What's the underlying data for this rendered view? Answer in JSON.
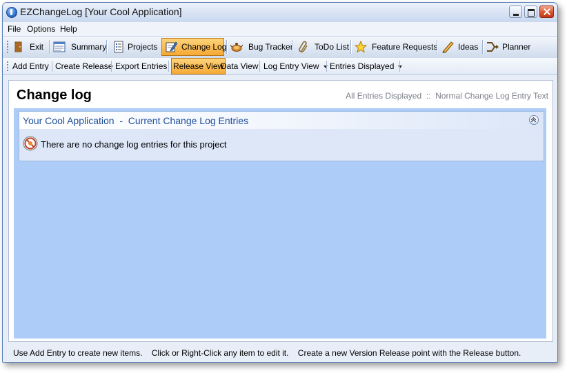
{
  "window": {
    "title": "EZChangeLog [Your Cool Application]"
  },
  "menu": [
    "File",
    "Options",
    "Help"
  ],
  "toolbar": {
    "buttons": [
      {
        "label": "Exit",
        "icon": "exit-icon"
      },
      {
        "label": "Summary",
        "icon": "summary-icon"
      },
      {
        "label": "Projects",
        "icon": "projects-icon"
      },
      {
        "label": "Change Log",
        "icon": "change-log-icon",
        "active": true
      },
      {
        "label": "Bug Tracker",
        "icon": "bug-tracker-icon"
      },
      {
        "label": "ToDo List",
        "icon": "paperclip-icon"
      },
      {
        "label": "Feature Requests",
        "icon": "star-icon"
      },
      {
        "label": "Ideas",
        "icon": "pencil-icon"
      },
      {
        "label": "Planner",
        "icon": "planner-icon"
      }
    ]
  },
  "subtoolbar": {
    "items": [
      "Add Entry",
      "Create Release",
      "Export Entries",
      "Release View",
      "Data View",
      "Log Entry View",
      "Entries Displayed"
    ],
    "active_item": "Release View"
  },
  "content": {
    "title": "Change log",
    "header_right": "All Entries Displayed  ::  Normal Change Log Entry Text",
    "panel": {
      "title": "Your Cool Application  -  Current Change Log Entries",
      "empty_message": "There are no change log entries for this project"
    }
  },
  "status": "Use Add Entry to create new items.    Click or Right-Click any item to edit it.    Create a new Version Release point with the Release button.",
  "colors": {
    "accent_active": "#f6a835",
    "content_blue": "#aeccf8",
    "panel_title": "#1f4f9c"
  }
}
